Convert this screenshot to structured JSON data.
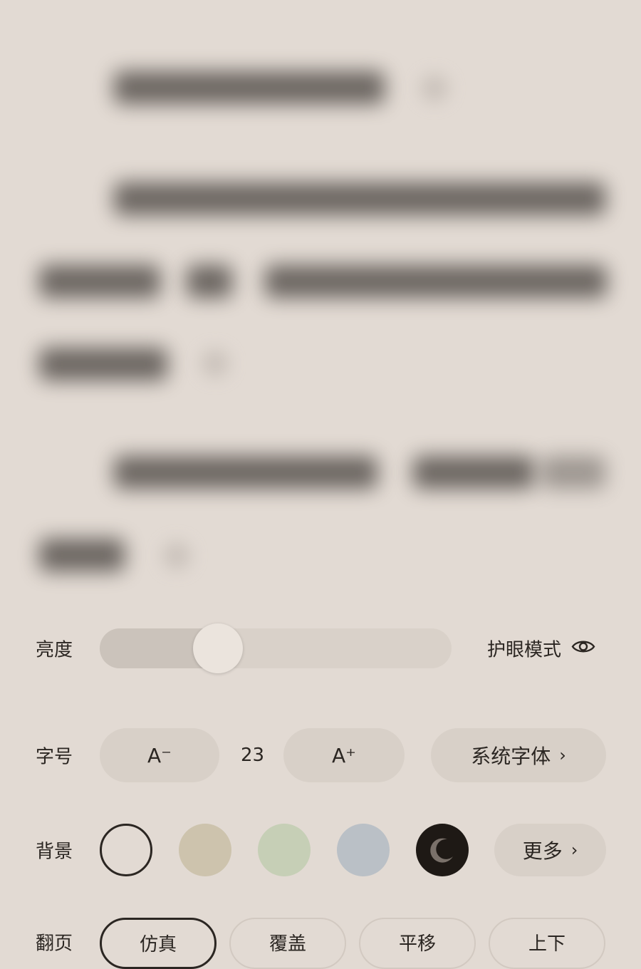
{
  "brightness": {
    "label": "亮度",
    "level": 0.31,
    "eye_mode_label": "护眼模式",
    "eye_icon": "eye-icon"
  },
  "font_size": {
    "label": "字号",
    "decrease_label": "A⁻",
    "value": "23",
    "increase_label": "A⁺",
    "font_family_label": "系统字体",
    "chevron": "›"
  },
  "background": {
    "label": "背景",
    "swatches": [
      {
        "name": "white",
        "color": "#e2dad3",
        "selected": true
      },
      {
        "name": "beige",
        "color": "#cdc3ad",
        "selected": false
      },
      {
        "name": "green",
        "color": "#c6cfb6",
        "selected": false
      },
      {
        "name": "blue",
        "color": "#bac0c6",
        "selected": false
      },
      {
        "name": "night",
        "color": "#1e1915",
        "selected": false
      }
    ],
    "more_label": "更多",
    "chevron": "›"
  },
  "page_turn": {
    "label": "翻页",
    "options": [
      "仿真",
      "覆盖",
      "平移",
      "上下"
    ],
    "selected_index": 0
  },
  "colors": {
    "accent_text": "#2b2622",
    "pill_bg": "#d8d0c8",
    "page_bg": "#e2dad3"
  }
}
